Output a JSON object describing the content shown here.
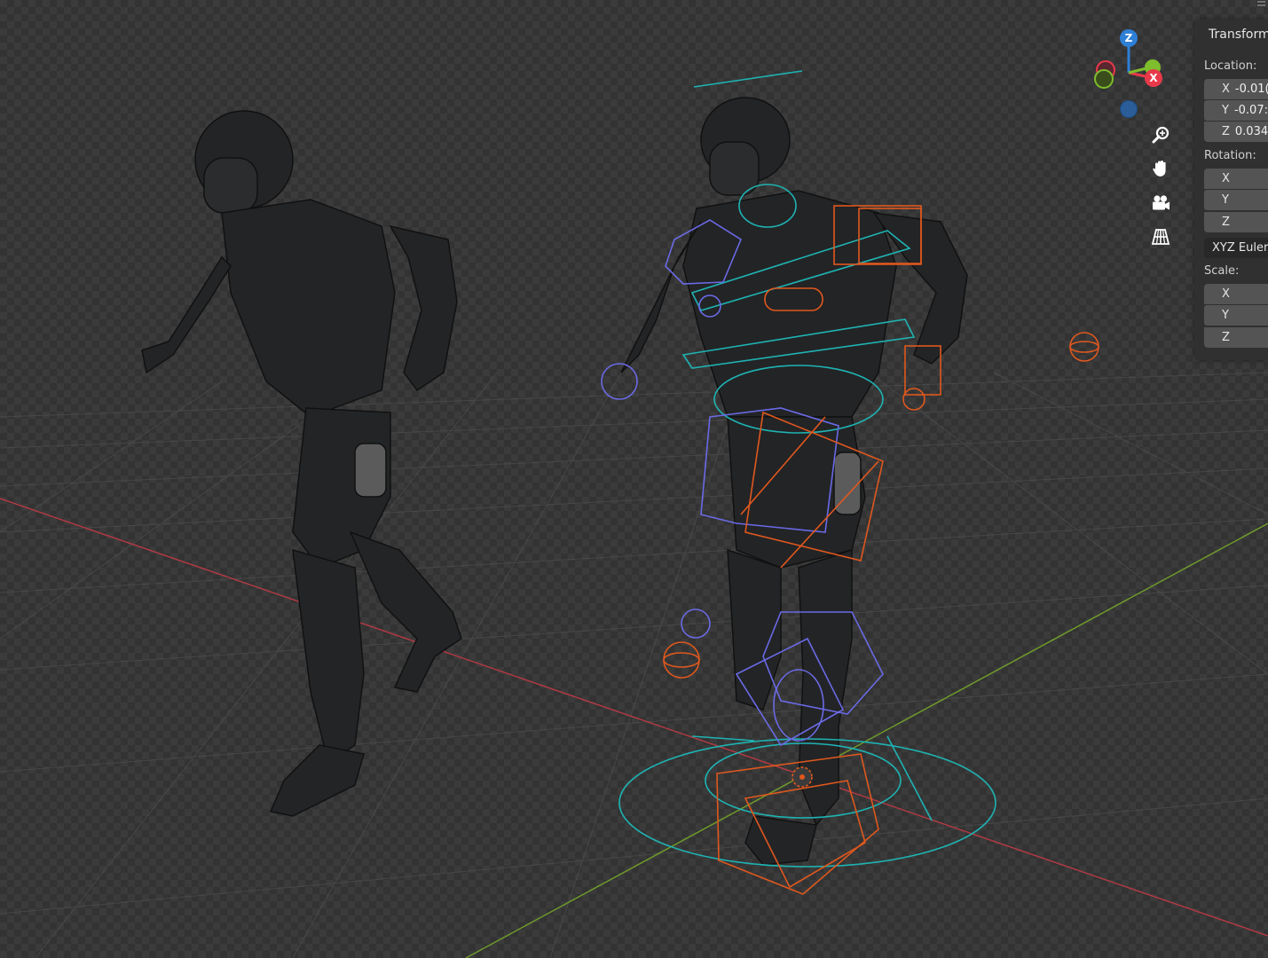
{
  "sidebar": {
    "panel_title": "Transform",
    "location_label": "Location:",
    "location": [
      {
        "axis": "X",
        "value": "-0.01("
      },
      {
        "axis": "Y",
        "value": "-0.07:"
      },
      {
        "axis": "Z",
        "value": "0.034"
      }
    ],
    "rotation_label": "Rotation:",
    "rotation": [
      {
        "axis": "X",
        "value": ""
      },
      {
        "axis": "Y",
        "value": ""
      },
      {
        "axis": "Z",
        "value": ""
      }
    ],
    "rotation_mode": "XYZ Euler",
    "scale_label": "Scale:",
    "scale": [
      {
        "axis": "X",
        "value": ""
      },
      {
        "axis": "Y",
        "value": ""
      },
      {
        "axis": "Z",
        "value": ""
      }
    ]
  },
  "gizmo": {
    "z_label": "Z",
    "x_label": "X",
    "colors": {
      "x": "#e8394a",
      "y": "#7ebd2c",
      "z": "#2e7fd6",
      "neg_y": "#5b8a2a",
      "neg_z": "#2b5d99"
    }
  },
  "nav_tools": {
    "zoom": "zoom-icon",
    "pan": "hand-icon",
    "camera": "camera-icon",
    "perspective": "grid-icon"
  },
  "scene": {
    "rig_colors": {
      "cyan": "#1fb3b3",
      "blue": "#6a6ae6",
      "orange": "#e0581e",
      "x_axis": "#b03a44",
      "y_axis": "#6f9a2b"
    }
  }
}
